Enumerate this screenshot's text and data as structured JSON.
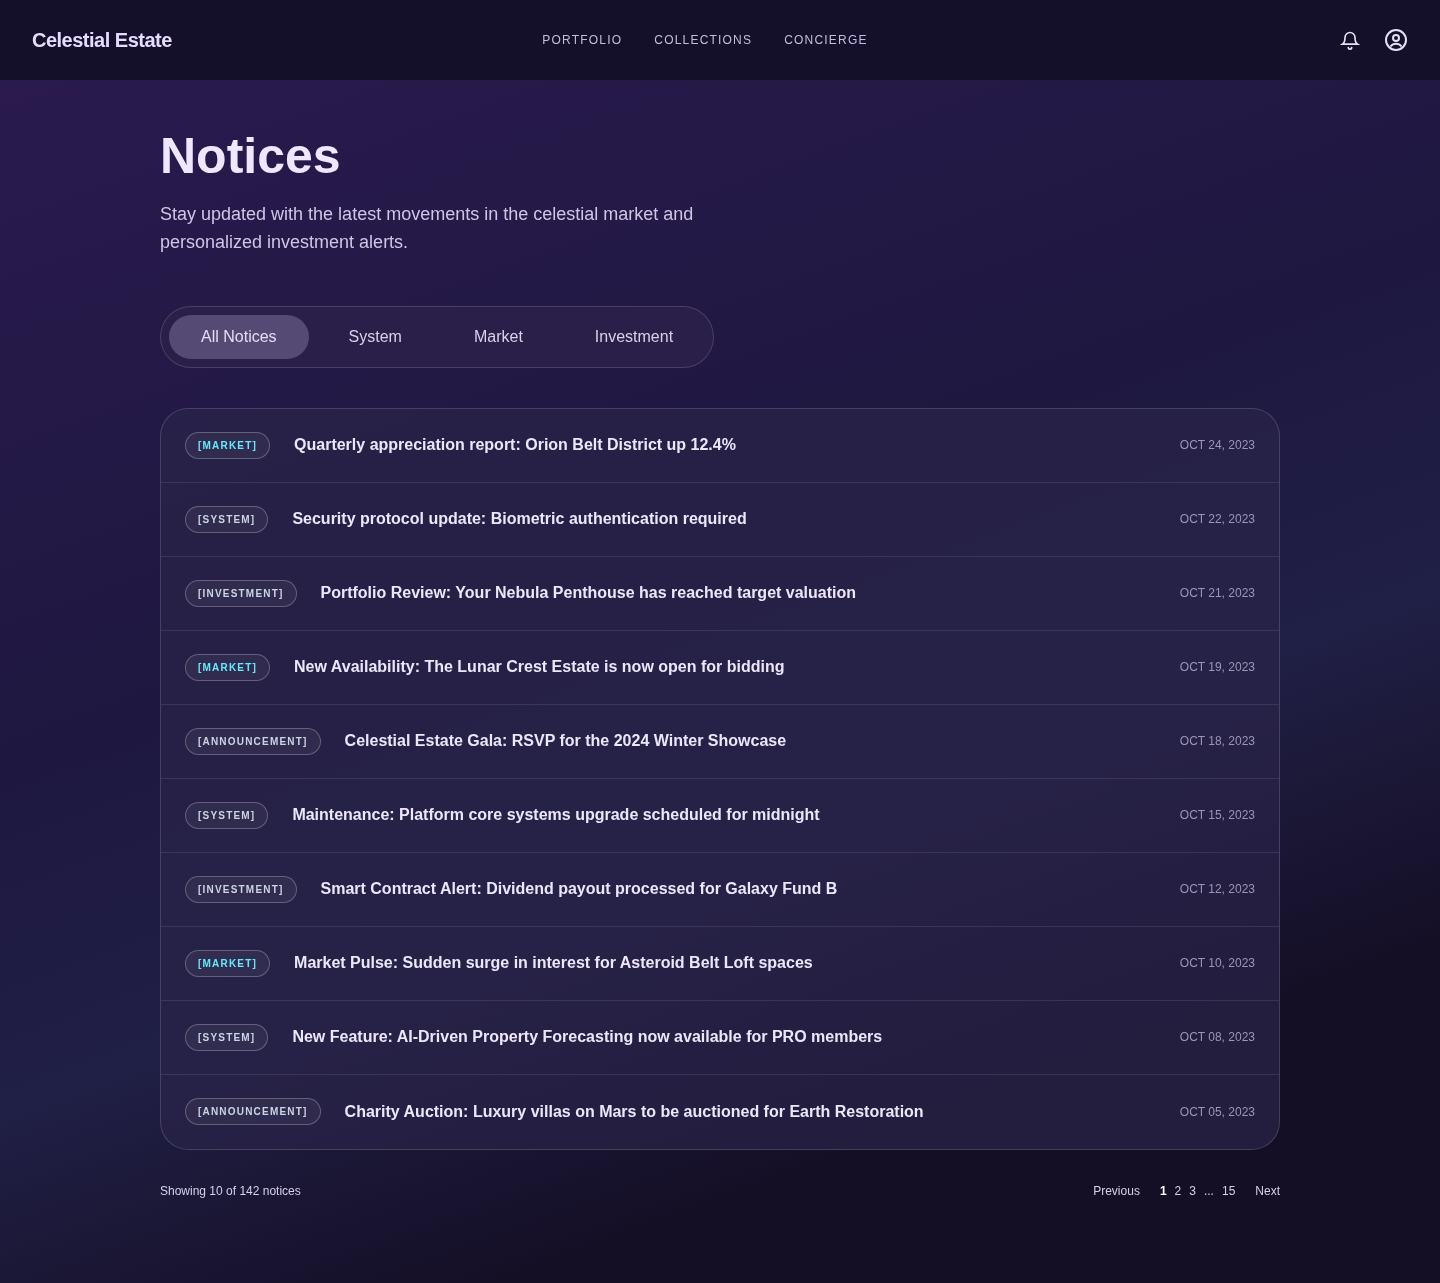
{
  "brand": "Celestial Estate",
  "nav": [
    "PORTFOLIO",
    "COLLECTIONS",
    "CONCIERGE"
  ],
  "title": "Notices",
  "subtitle": "Stay updated with the latest movements in the celestial market and personalized investment alerts.",
  "tabs": [
    {
      "label": "All Notices",
      "selected": true
    },
    {
      "label": "System",
      "selected": false
    },
    {
      "label": "Market",
      "selected": false
    },
    {
      "label": "Investment",
      "selected": false
    }
  ],
  "notices": [
    {
      "tag": "[MARKET]",
      "color": "#67e8f9",
      "title": "Quarterly appreciation report: Orion Belt District up 12.4%",
      "date": "OCT 24, 2023"
    },
    {
      "tag": "[SYSTEM]",
      "color": "#cbd5e1",
      "title": "Security protocol update: Biometric authentication required",
      "date": "OCT 22, 2023"
    },
    {
      "tag": "[INVESTMENT]",
      "color": "#cbd5e1",
      "title": "Portfolio Review: Your Nebula Penthouse has reached target valuation",
      "date": "OCT 21, 2023"
    },
    {
      "tag": "[MARKET]",
      "color": "#67e8f9",
      "title": "New Availability: The Lunar Crest Estate is now open for bidding",
      "date": "OCT 19, 2023"
    },
    {
      "tag": "[ANNOUNCEMENT]",
      "color": "#cbd5e1",
      "title": "Celestial Estate Gala: RSVP for the 2024 Winter Showcase",
      "date": "OCT 18, 2023"
    },
    {
      "tag": "[SYSTEM]",
      "color": "#cbd5e1",
      "title": "Maintenance: Platform core systems upgrade scheduled for midnight",
      "date": "OCT 15, 2023"
    },
    {
      "tag": "[INVESTMENT]",
      "color": "#cbd5e1",
      "title": "Smart Contract Alert: Dividend payout processed for Galaxy Fund B",
      "date": "OCT 12, 2023"
    },
    {
      "tag": "[MARKET]",
      "color": "#67e8f9",
      "title": "Market Pulse: Sudden surge in interest for Asteroid Belt Loft spaces",
      "date": "OCT 10, 2023"
    },
    {
      "tag": "[SYSTEM]",
      "color": "#cbd5e1",
      "title": "New Feature: AI-Driven Property Forecasting now available for PRO members",
      "date": "OCT 08, 2023"
    },
    {
      "tag": "[ANNOUNCEMENT]",
      "color": "#cbd5e1",
      "title": "Charity Auction: Luxury villas on Mars to be auctioned for Earth Restoration",
      "date": "OCT 05, 2023"
    }
  ],
  "footer": {
    "summary": "Showing 10 of 142 notices",
    "previous": "Previous",
    "pages": [
      {
        "label": "1",
        "selected": true
      },
      {
        "label": "2",
        "selected": false
      },
      {
        "label": "3",
        "selected": false
      },
      {
        "label": "...",
        "selected": false
      },
      {
        "label": "15",
        "selected": false
      }
    ],
    "next": "Next"
  }
}
